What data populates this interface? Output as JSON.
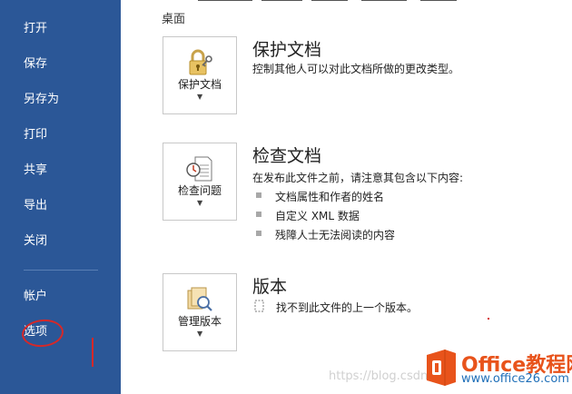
{
  "sidebar": {
    "items": [
      {
        "label": "打开"
      },
      {
        "label": "保存"
      },
      {
        "label": "另存为"
      },
      {
        "label": "打印"
      },
      {
        "label": "共享"
      },
      {
        "label": "导出"
      },
      {
        "label": "关闭"
      },
      {
        "label": "帐户"
      },
      {
        "label": "选项"
      }
    ]
  },
  "header": {
    "location": "桌面"
  },
  "sections": {
    "protect": {
      "button_label": "保护文档",
      "title": "保护文档",
      "description": "控制其他人可以对此文档所做的更改类型。"
    },
    "inspect": {
      "button_label": "检查问题",
      "title": "检查文档",
      "description": "在发布此文件之前，请注意其包含以下内容:",
      "bullets": [
        "文档属性和作者的姓名",
        "自定义 XML 数据",
        "残障人士无法阅读的内容"
      ]
    },
    "versions": {
      "button_label": "管理版本",
      "title": "版本",
      "description": "找不到此文件的上一个版本。"
    }
  },
  "watermark": "https://blog.csdn",
  "logo": {
    "title": "Office教程网",
    "url": "www.office26.com"
  },
  "colors": {
    "sidebar": "#2b5797",
    "logo_orange": "#e8531b",
    "logo_blue": "#1f6fb8",
    "annotation_red": "#d62828"
  }
}
